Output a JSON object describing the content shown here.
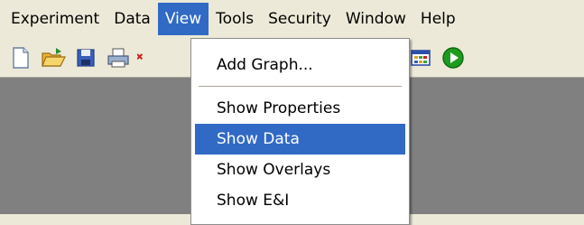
{
  "menubar": {
    "items": [
      {
        "label": "Experiment"
      },
      {
        "label": "Data"
      },
      {
        "label": "View"
      },
      {
        "label": "Tools"
      },
      {
        "label": "Security"
      },
      {
        "label": "Window"
      },
      {
        "label": "Help"
      }
    ],
    "active_index": 2
  },
  "toolbar": {
    "buttons": [
      {
        "icon": "new-document-icon"
      },
      {
        "icon": "open-folder-icon"
      },
      {
        "icon": "save-disk-icon"
      },
      {
        "icon": "print-icon"
      },
      {
        "icon": "delete-icon"
      },
      {
        "icon": "chart-icon"
      },
      {
        "icon": "undo-icon"
      },
      {
        "icon": "redo-icon"
      },
      {
        "icon": "grid-icon"
      },
      {
        "icon": "run-icon"
      }
    ]
  },
  "view_menu": {
    "items": [
      {
        "label": "Add Graph..."
      },
      {
        "label": "Show Properties"
      },
      {
        "label": "Show Data"
      },
      {
        "label": "Show Overlays"
      },
      {
        "label": "Show E&I"
      }
    ],
    "highlighted_index": 2
  },
  "colors": {
    "menu_face": "#ece9d8",
    "workspace": "#808080",
    "highlight": "#316ac5",
    "run_green": "#1f9c1f"
  }
}
